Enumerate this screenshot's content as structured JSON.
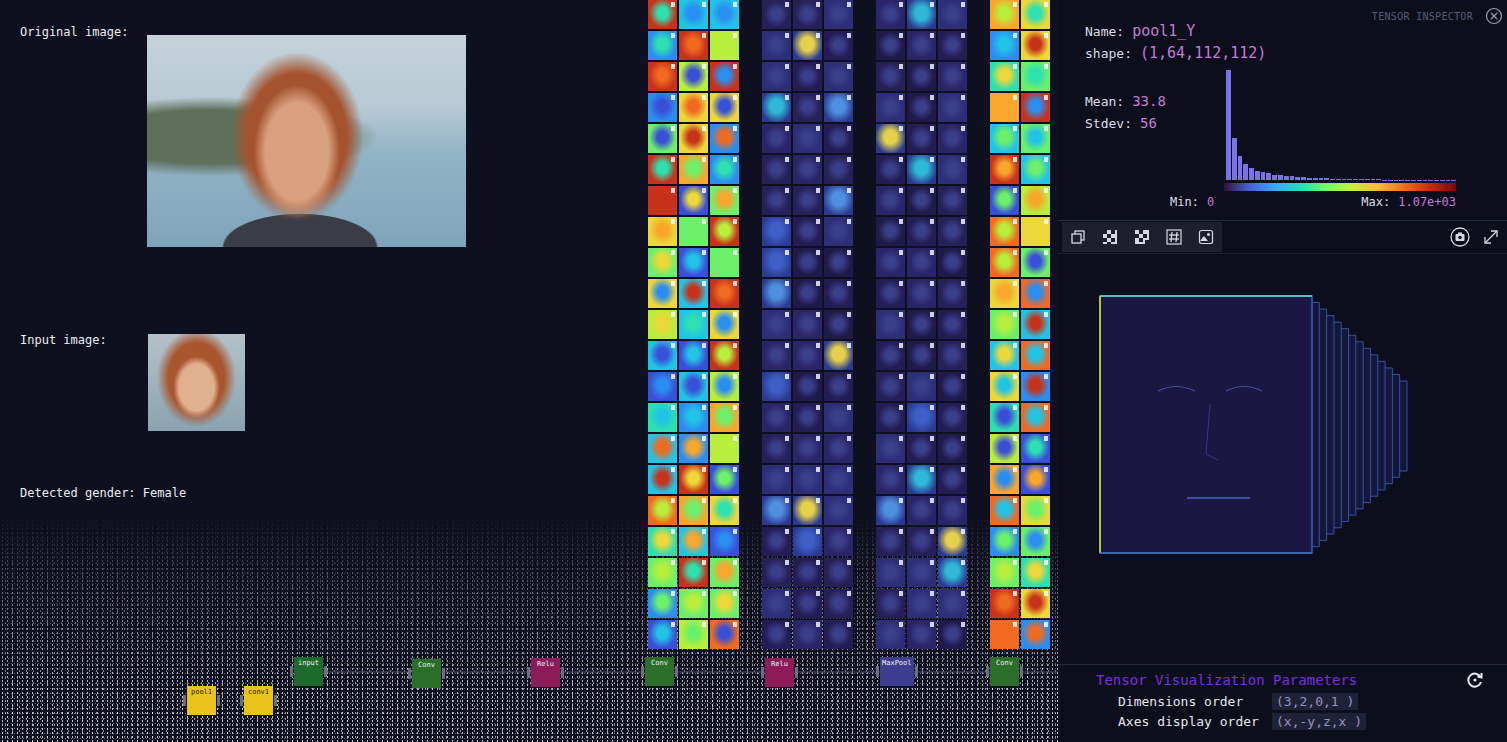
{
  "left": {
    "original_label": "Original image:",
    "input_label": "Input image:",
    "result_label": "Detected gender: Female"
  },
  "feature_maps": {
    "rows": 21,
    "groups": [
      {
        "kind": "heat",
        "columns": 3
      },
      {
        "kind": "dark",
        "columns": 3
      },
      {
        "kind": "dark",
        "columns": 3
      },
      {
        "kind": "heat",
        "columns": 2
      }
    ]
  },
  "graph": {
    "nodes": [
      {
        "label": "pool1",
        "color": "#e9c21c"
      },
      {
        "label": "conv1",
        "color": "#e9c21c"
      },
      {
        "label": "input",
        "color": "#1d6b2c"
      },
      {
        "label": "Conv",
        "color": "#2a6e2a"
      },
      {
        "label": "Relu",
        "color": "#8c1b5a"
      },
      {
        "label": "Conv",
        "color": "#2a6e2a"
      },
      {
        "label": "Relu",
        "color": "#8c1b5a"
      },
      {
        "label": "MaxPool",
        "color": "#3d3d90"
      },
      {
        "label": "Conv",
        "color": "#2a6e2a"
      }
    ]
  },
  "inspector": {
    "title": "TENSOR INSPECTOR",
    "name_label": "Name:",
    "name": "pool1_Y",
    "shape_label": "shape:",
    "shape": "(1,64,112,112)",
    "mean_label": "Mean:",
    "mean": "33.8",
    "stdev_label": "Stdev:",
    "stdev": "56",
    "min_label": "Min:",
    "min": "0",
    "max_label": "Max:",
    "max": "1.07e+03",
    "histogram": [
      100,
      38,
      22,
      15,
      11,
      8.5,
      7,
      6,
      5,
      4.3,
      3.7,
      3.2,
      2.8,
      2.4,
      2.1,
      1.8,
      1.6,
      1.4,
      1.2,
      1.1,
      1,
      0.9,
      0.8,
      0.7,
      0.6,
      0.5,
      0.5,
      0.4,
      0.4,
      0.3,
      0.3,
      0.3,
      0.2,
      0.2,
      0.2,
      0.1,
      0.1,
      0.1,
      0.1,
      0.1
    ]
  },
  "params": {
    "title": "Tensor Visualization Parameters",
    "rows": [
      {
        "label": "Dimensions order",
        "value": "(3,2,0,1 )"
      },
      {
        "label": "Axes display order",
        "value": "(x,-y,z,x )"
      }
    ]
  }
}
